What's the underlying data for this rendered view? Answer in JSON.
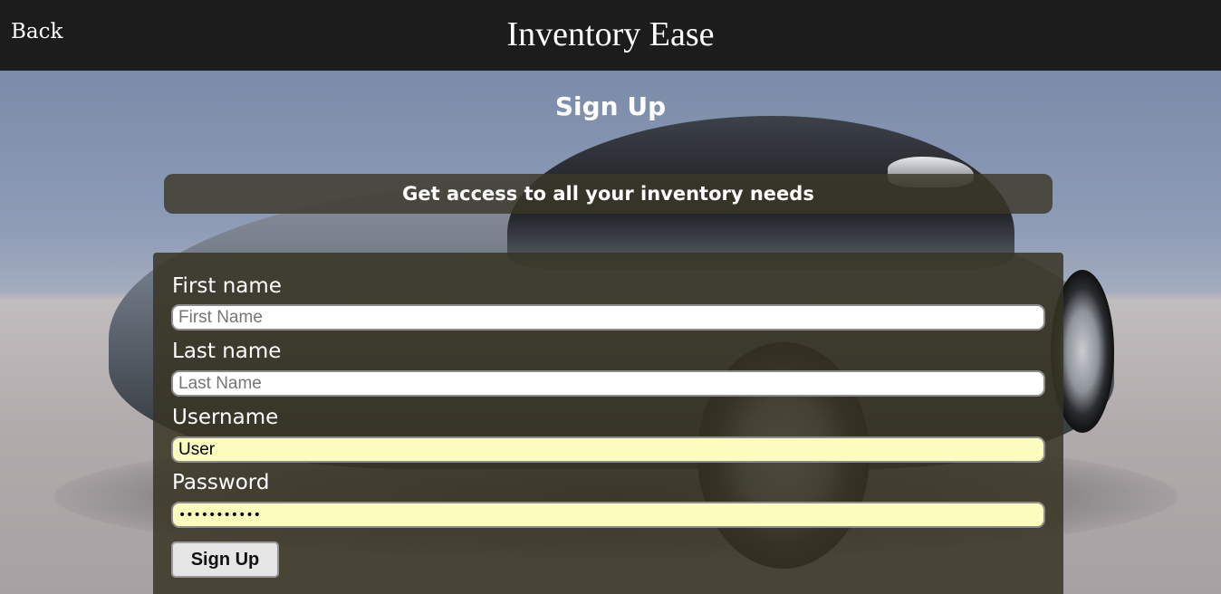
{
  "header": {
    "back_label": "Back",
    "app_title": "Inventory Ease"
  },
  "page": {
    "heading": "Sign Up",
    "tagline": "Get access to all your inventory needs"
  },
  "form": {
    "first_name": {
      "label": "First name",
      "placeholder": "First Name",
      "value": ""
    },
    "last_name": {
      "label": "Last name",
      "placeholder": "Last Name",
      "value": ""
    },
    "username": {
      "label": "Username",
      "placeholder": "",
      "value": "User"
    },
    "password": {
      "label": "Password",
      "placeholder": "",
      "value": "•••••••••••"
    },
    "submit_label": "Sign Up"
  },
  "colors": {
    "header_bg": "#1c1c1c",
    "panel_bg": "#38342a",
    "autofill_bg": "#fbfdbf"
  }
}
